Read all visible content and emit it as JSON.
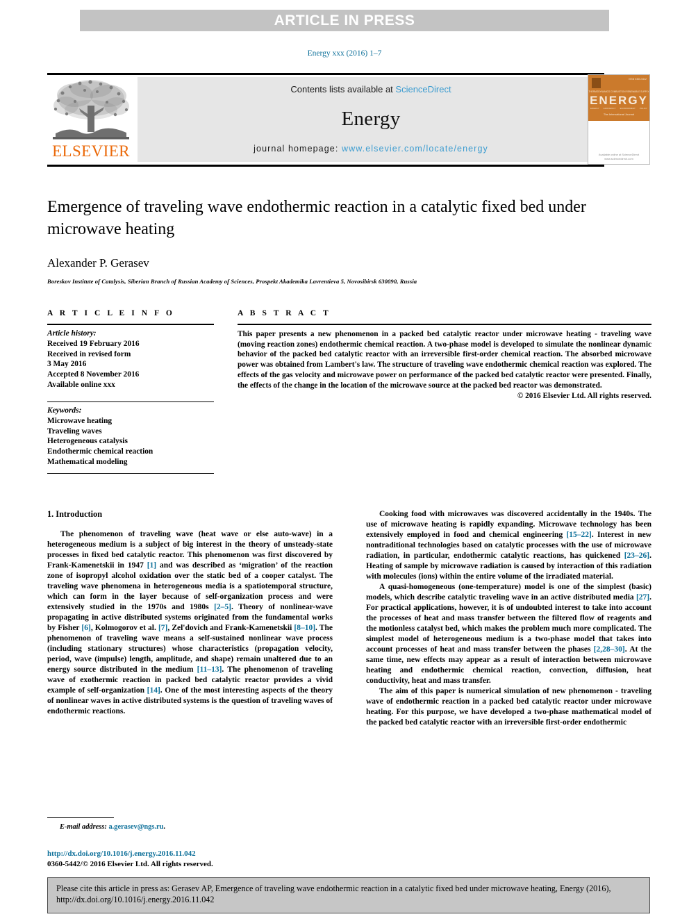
{
  "banner": {
    "text": "ARTICLE IN PRESS"
  },
  "running_head": "Energy xxx (2016) 1–7",
  "masthead": {
    "contents_prefix": "Contents lists available at ",
    "contents_link": "ScienceDirect",
    "journal_name": "Energy",
    "homepage_prefix": "journal homepage: ",
    "homepage_url": "www.elsevier.com/locate/energy",
    "publisher_wordmark": "ELSEVIER",
    "cover": {
      "title": "ENERGY",
      "issn": "ISSN 0360-5442",
      "kicker": [
        "THERMODYNAMICS",
        "COMBUSTION",
        "RENEWABLE",
        "SUPPLY"
      ],
      "sub": [
        "ENERGY",
        "EFFICIENCY",
        "ENVIRONMENT",
        "POLICY"
      ],
      "tagline": "The International Journal",
      "footer": "Available online at\nScienceDirect\nwww.sciencedirect.com"
    }
  },
  "article": {
    "title": "Emergence of traveling wave endothermic reaction in a catalytic fixed bed under microwave heating",
    "authors": "Alexander P. Gerasev",
    "affiliation": "Boreskov Institute of Catalysis, Siberian Branch of Russian Academy of Sciences, Prospekt Akademika Lavrentieva 5, Novosibirsk 630090, Russia"
  },
  "article_info": {
    "heading": "A R T I C L E  I N F O",
    "history_label": "Article history:",
    "history": [
      "Received 19 February 2016",
      "Received in revised form",
      "3 May 2016",
      "Accepted 8 November 2016",
      "Available online xxx"
    ],
    "keywords_label": "Keywords:",
    "keywords": [
      "Microwave heating",
      "Traveling waves",
      "Heterogeneous catalysis",
      "Endothermic chemical reaction",
      "Mathematical modeling"
    ]
  },
  "abstract": {
    "heading": "A B S T R A C T",
    "text": "This paper presents a new phenomenon in a packed bed catalytic reactor under microwave heating - traveling wave (moving reaction zones) endothermic chemical reaction. A two-phase model is developed to simulate the nonlinear dynamic behavior of the packed bed catalytic reactor with an irreversible first-order chemical reaction. The absorbed microwave power was obtained from Lambert's law. The structure of traveling wave endothermic chemical reaction was explored. The effects of the gas velocity and microwave power on performance of the packed bed catalytic reactor were presented. Finally, the effects of the change in the location of the microwave source at the packed bed reactor was demonstrated.",
    "copyright": "© 2016 Elsevier Ltd. All rights reserved."
  },
  "body": {
    "section_title": "1. Introduction",
    "left_paragraph_1_parts": [
      "The phenomenon of traveling wave (heat wave or else auto-wave) in a heterogeneous medium is a subject of big interest in the theory of unsteady-state processes in fixed bed catalytic reactor. This phenomenon was first discovered by Frank-Kamenetskii in 1947 ",
      "[1]",
      " and was described as ‘migration’ of the reaction zone of isopropyl alcohol oxidation over the static bed of a cooper catalyst. The traveling wave phenomena in heterogeneous media is a spatiotemporal structure, which can form in the layer because of self-organization process and were extensively studied in the 1970s and 1980s ",
      "[2–5]",
      ". Theory of nonlinear-wave propagating in active distributed systems originated from the fundamental works by Fisher ",
      "[6]",
      ", Kolmogorov et al. ",
      "[7]",
      ", Zel'dovich and Frank-Kamenetskii ",
      "[8–10]",
      ". The phenomenon of traveling wave means a self-sustained nonlinear wave process (including stationary structures) whose characteristics (propagation velocity, period, wave (impulse) length, amplitude, and shape) remain unaltered due to an energy source distributed in the medium ",
      "[11–13]",
      ". The phenomenon of traveling wave of exothermic reaction in packed bed catalytic reactor provides a vivid example of self-organization ",
      "[14]",
      ". One of the most interesting aspects of the theory of nonlinear waves in active distributed systems is the question of traveling waves of endothermic reactions."
    ],
    "right_paragraph_1_parts": [
      "Cooking food with microwaves was discovered accidentally in the 1940s. The use of microwave heating is rapidly expanding. Microwave technology has been extensively employed in food and chemical engineering ",
      "[15–22]",
      ". Interest in new nontraditional technologies based on catalytic processes with the use of microwave radiation, in particular, endothermic catalytic reactions, has quickened ",
      "[23–26]",
      ". Heating of sample by microwave radiation is caused by interaction of this radiation with molecules (ions) within the entire volume of the irradiated material."
    ],
    "right_paragraph_2_parts": [
      "A quasi-homogeneous (one-temperature) model is one of the simplest (basic) models, which describe catalytic traveling wave in an active distributed media ",
      "[27]",
      ". For practical applications, however, it is of undoubted interest to take into account the processes of heat and mass transfer between the filtered flow of reagents and the motionless catalyst bed, which makes the problem much more complicated. The simplest model of heterogeneous medium is a two-phase model that takes into account processes of heat and mass transfer between the phases ",
      "[2,28–30]",
      ". At the same time, new effects may appear as a result of interaction between microwave heating and endothermic chemical reaction, convection, diffusion, heat conductivity, heat and mass transfer."
    ],
    "right_paragraph_3_parts": [
      "The aim of this paper is numerical simulation of new phenomenon - traveling wave of endothermic reaction in a packed bed catalytic reactor under microwave heating. For this purpose, we have developed a two-phase mathematical model of the packed bed catalytic reactor with an irreversible first-order endothermic"
    ]
  },
  "footnote": {
    "label": "E-mail address:",
    "email": "a.gerasev@ngs.ru",
    "trailing": "."
  },
  "doi": {
    "link": "http://dx.doi.org/10.1016/j.energy.2016.11.042",
    "copyright": "0360-5442/© 2016 Elsevier Ltd. All rights reserved."
  },
  "cite_box": {
    "text": "Please cite this article in press as: Gerasev AP, Emergence of traveling wave endothermic reaction in a catalytic fixed bed under microwave heating, Energy (2016), http://dx.doi.org/10.1016/j.energy.2016.11.042"
  },
  "colors": {
    "link": "#0c6f99",
    "sciencedirect": "#3c9cd0",
    "elsevier_orange": "#eb6909",
    "banner_gray": "#c3c3c3",
    "masthead_gray": "#e6e6e6",
    "cite_gray": "#c6c6c6",
    "cover_orange": "#cb7a2c"
  }
}
